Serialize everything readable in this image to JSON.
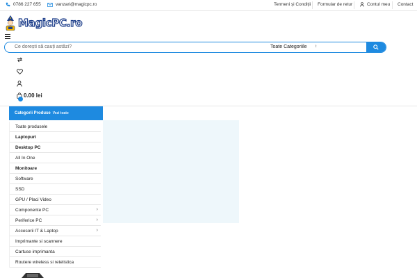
{
  "topbar": {
    "phone": "0786 227 655",
    "email": "vanzari@magicpc.ro",
    "links": [
      "Termeni și Condiții",
      "Formular de retur",
      "Contul meu",
      "Contact"
    ]
  },
  "header": {
    "logo_text": "MagicPC.ro",
    "search_placeholder": "Ce dorești să cauți astăzi?",
    "search_category": "Toate Categoriile",
    "cart_amount": "0.00 lei"
  },
  "categories": {
    "title": "Categorii Produse",
    "view_all": "Vezi toate",
    "items": [
      {
        "label": "Toate produsele",
        "bold": false,
        "submenu": false
      },
      {
        "label": "Laptopuri",
        "bold": true,
        "submenu": false
      },
      {
        "label": "Desktop PC",
        "bold": true,
        "submenu": false
      },
      {
        "label": "All In One",
        "bold": false,
        "submenu": false
      },
      {
        "label": "Monitoare",
        "bold": true,
        "submenu": false
      },
      {
        "label": "Software",
        "bold": false,
        "submenu": false
      },
      {
        "label": "SSD",
        "bold": false,
        "submenu": false
      },
      {
        "label": "GPU / Placi Video",
        "bold": false,
        "submenu": false
      },
      {
        "label": "Componente PC",
        "bold": false,
        "submenu": true
      },
      {
        "label": "Periferice PC",
        "bold": false,
        "submenu": true
      },
      {
        "label": "Accesorii IT & Laptop",
        "bold": false,
        "submenu": true
      },
      {
        "label": "Imprimante si scannere",
        "bold": false,
        "submenu": false
      },
      {
        "label": "Cartuse imprimanta",
        "bold": false,
        "submenu": false
      },
      {
        "label": "Routere wireless si retelistica",
        "bold": false,
        "submenu": false
      }
    ]
  },
  "colors": {
    "accent": "#1e8ae0",
    "hero_bg": "#eef7fb",
    "logo_outline": "#1d3e8a"
  }
}
